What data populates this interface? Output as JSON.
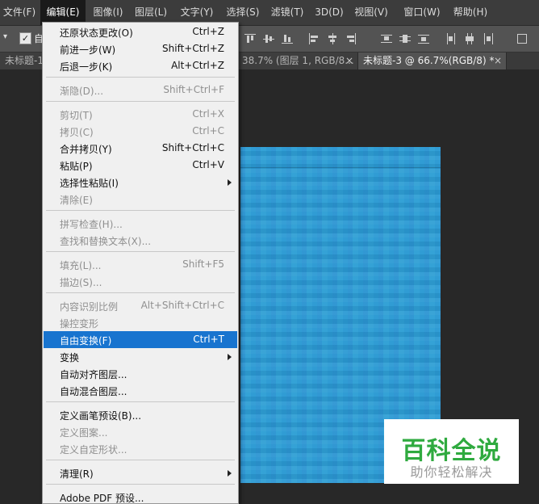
{
  "menubar": {
    "items": [
      "文件(F)",
      "编辑(E)",
      "图像(I)",
      "图层(L)",
      "文字(Y)",
      "选择(S)",
      "滤镜(T)",
      "3D(D)",
      "视图(V)",
      "窗口(W)",
      "帮助(H)"
    ],
    "active": "编辑(E)"
  },
  "options_bar": {
    "arrow": "▾",
    "auto_select_checked": true,
    "auto_select_label": "自"
  },
  "tabs": [
    {
      "label": "未标题-1",
      "active": false
    },
    {
      "label": "38.7% (图层 1, RGB/8...",
      "close": "×",
      "active": false
    },
    {
      "label": "未标题-3 @ 66.7%(RGB/8) *",
      "close": "×",
      "active": true
    }
  ],
  "edit_menu": {
    "items": [
      {
        "label": "还原状态更改(O)",
        "shortcut": "Ctrl+Z",
        "disabled": false
      },
      {
        "label": "前进一步(W)",
        "shortcut": "Shift+Ctrl+Z",
        "disabled": false
      },
      {
        "label": "后退一步(K)",
        "shortcut": "Alt+Ctrl+Z",
        "disabled": false
      },
      {
        "label": "渐隐(D)...",
        "shortcut": "Shift+Ctrl+F",
        "disabled": true
      },
      {
        "label": "剪切(T)",
        "shortcut": "Ctrl+X",
        "disabled": true
      },
      {
        "label": "拷贝(C)",
        "shortcut": "Ctrl+C",
        "disabled": true
      },
      {
        "label": "合并拷贝(Y)",
        "shortcut": "Shift+Ctrl+C",
        "disabled": false
      },
      {
        "label": "粘贴(P)",
        "shortcut": "Ctrl+V",
        "disabled": false
      },
      {
        "label": "选择性粘贴(I)",
        "shortcut": "",
        "submenu": true,
        "disabled": false
      },
      {
        "label": "清除(E)",
        "shortcut": "",
        "disabled": true
      },
      {
        "label": "拼写检查(H)...",
        "shortcut": "",
        "disabled": true
      },
      {
        "label": "查找和替换文本(X)...",
        "shortcut": "",
        "disabled": true
      },
      {
        "label": "填充(L)...",
        "shortcut": "Shift+F5",
        "disabled": true
      },
      {
        "label": "描边(S)...",
        "shortcut": "",
        "disabled": true
      },
      {
        "label": "内容识别比例",
        "shortcut": "Alt+Shift+Ctrl+C",
        "disabled": true
      },
      {
        "label": "操控变形",
        "shortcut": "",
        "disabled": true
      },
      {
        "label": "自由变换(F)",
        "shortcut": "Ctrl+T",
        "disabled": false,
        "highlighted": true
      },
      {
        "label": "变换",
        "shortcut": "",
        "submenu": true,
        "disabled": false
      },
      {
        "label": "自动对齐图层...",
        "shortcut": "",
        "disabled": false
      },
      {
        "label": "自动混合图层...",
        "shortcut": "",
        "disabled": false
      },
      {
        "label": "定义画笔预设(B)...",
        "shortcut": "",
        "disabled": false
      },
      {
        "label": "定义图案...",
        "shortcut": "",
        "disabled": true
      },
      {
        "label": "定义自定形状...",
        "shortcut": "",
        "disabled": true
      },
      {
        "label": "清理(R)",
        "shortcut": "",
        "submenu": true,
        "disabled": false
      },
      {
        "label": "Adobe PDF 预设...",
        "shortcut": "",
        "disabled": false
      }
    ]
  },
  "watermark": {
    "title": "百科全说",
    "subtitle": "助你轻松解决"
  },
  "colors": {
    "menubar_bg": "#3c3c3c",
    "menu_bg": "#f0f0f0",
    "highlight": "#1874cf",
    "canvas": "#2b9bd3",
    "watermark_green": "#2faa3f"
  }
}
